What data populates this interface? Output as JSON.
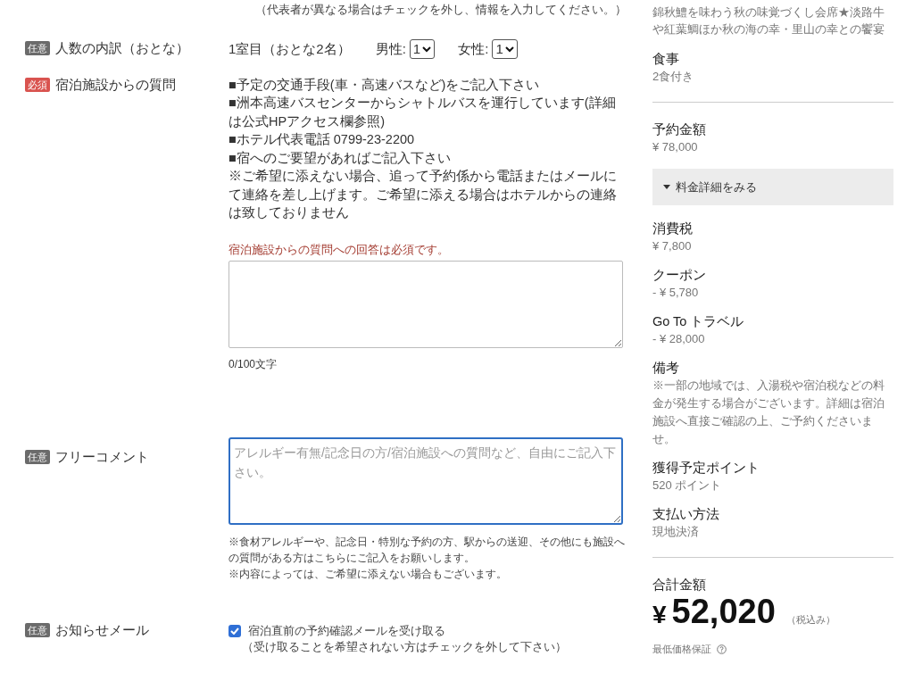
{
  "top_note": "（代表者が異なる場合はチェックを外し、情報を入力してください。）",
  "fields": [
    {
      "kind": "party",
      "badge": "任意",
      "required": false,
      "label": "人数の内訳（おとな）",
      "room": "1室目（おとな2名）",
      "selects": [
        {
          "label": "男性:",
          "value": "1"
        },
        {
          "label": "女性:",
          "value": "1"
        }
      ]
    },
    {
      "kind": "question",
      "badge": "必須",
      "required": true,
      "label": "宿泊施設からの質問",
      "instructions": [
        "■予定の交通手段(車・高速バスなど)をご記入下さい",
        "■洲本高速バスセンターからシャトルバスを運行しています(詳細は公式HPアクセス欄参照)",
        "■ホテル代表電話 0799-23-2200",
        "■宿へのご要望があればご記入下さい",
        "※ご希望に添えない場合、追って予約係から電話またはメールにて連絡を差し上げます。ご希望に添える場合はホテルからの連絡は致しておりません"
      ],
      "error": "宿泊施設からの質問への回答は必須です。",
      "counter": "0/100文字"
    },
    {
      "kind": "comment",
      "badge": "任意",
      "required": false,
      "label": "フリーコメント",
      "placeholder": "アレルギー有無/記念日の方/宿泊施設への質問など、自由にご記入下さい。",
      "focused": true,
      "notes": [
        "※食材アレルギーや、記念日・特別な予約の方、駅からの送迎、その他にも施設への質問がある方はこちらにご記入をお願いします。",
        "※内容によっては、ご希望に添えない場合もございます。"
      ]
    },
    {
      "kind": "checkbox",
      "badge": "任意",
      "required": false,
      "label": "お知らせメール",
      "option": "宿泊直前の予約確認メールを受け取る",
      "checked": true,
      "hint": "（受け取ることを希望されない方はチェックを外して下さい）"
    }
  ],
  "summary": {
    "plan": "錦秋鱧を味わう秋の味覚づくし会席★淡路牛や紅葉鯛ほか秋の海の幸・里山の幸との饗宴",
    "meal": {
      "label": "食事",
      "value": "2食付き"
    },
    "price": {
      "label": "予約金額",
      "value": "¥ 78,000"
    },
    "details_button": "料金詳細をみる",
    "breakdown": [
      {
        "label": "消費税",
        "value": "¥ 7,800"
      },
      {
        "label": "クーポン",
        "value": "- ¥ 5,780"
      },
      {
        "label": "Go To トラベル",
        "value": "- ¥ 28,000"
      },
      {
        "label": "備考",
        "value": "※一部の地域では、入湯税や宿泊税などの料金が発生する場合がございます。詳細は宿泊施設へ直接ご確認の上、ご予約くださいませ。"
      },
      {
        "label": "獲得予定ポイント",
        "value": "520 ポイント"
      },
      {
        "label": "支払い方法",
        "value": "現地決済"
      }
    ],
    "total": {
      "label": "合計金額",
      "currency": "¥",
      "amount": "52,020",
      "tax_note": "（税込み）"
    },
    "guarantee": "最低価格保証"
  }
}
